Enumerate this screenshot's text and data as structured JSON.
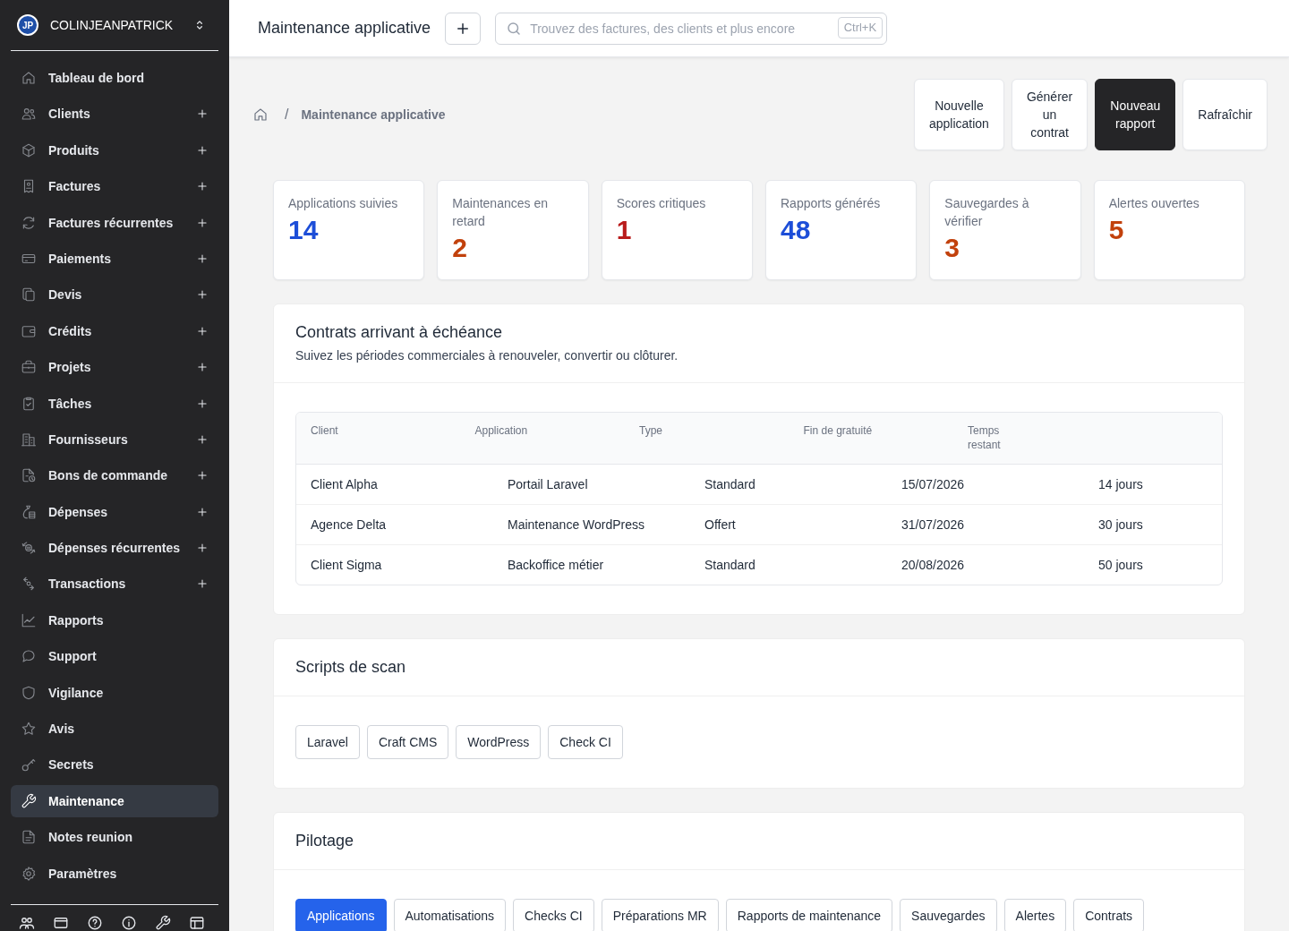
{
  "sidebar": {
    "account": {
      "initials": "JP",
      "name": "COLINJEANPATRICK"
    },
    "items": [
      {
        "label": "Tableau de bord",
        "can_add": false,
        "selected": false
      },
      {
        "label": "Clients",
        "can_add": true,
        "selected": false
      },
      {
        "label": "Produits",
        "can_add": true,
        "selected": false
      },
      {
        "label": "Factures",
        "can_add": true,
        "selected": false
      },
      {
        "label": "Factures récurrentes",
        "can_add": true,
        "selected": false
      },
      {
        "label": "Paiements",
        "can_add": true,
        "selected": false
      },
      {
        "label": "Devis",
        "can_add": true,
        "selected": false
      },
      {
        "label": "Crédits",
        "can_add": true,
        "selected": false
      },
      {
        "label": "Projets",
        "can_add": true,
        "selected": false
      },
      {
        "label": "Tâches",
        "can_add": true,
        "selected": false
      },
      {
        "label": "Fournisseurs",
        "can_add": true,
        "selected": false
      },
      {
        "label": "Bons de commande",
        "can_add": true,
        "selected": false
      },
      {
        "label": "Dépenses",
        "can_add": true,
        "selected": false
      },
      {
        "label": "Dépenses récurrentes",
        "can_add": true,
        "selected": false
      },
      {
        "label": "Transactions",
        "can_add": true,
        "selected": false
      },
      {
        "label": "Rapports",
        "can_add": false,
        "selected": false
      },
      {
        "label": "Support",
        "can_add": false,
        "selected": false
      },
      {
        "label": "Vigilance",
        "can_add": false,
        "selected": false
      },
      {
        "label": "Avis",
        "can_add": false,
        "selected": false
      },
      {
        "label": "Secrets",
        "can_add": false,
        "selected": false
      },
      {
        "label": "Maintenance",
        "can_add": false,
        "selected": true
      },
      {
        "label": "Notes reunion",
        "can_add": false,
        "selected": false
      },
      {
        "label": "Paramètres",
        "can_add": false,
        "selected": false
      }
    ]
  },
  "topbar": {
    "title": "Maintenance applicative",
    "search": {
      "placeholder": "Trouvez des factures, des clients et plus encore",
      "shortcut": "Ctrl+K"
    }
  },
  "breadcrumb": {
    "separator": "/",
    "current": "Maintenance applicative"
  },
  "actions": [
    {
      "label": "Nouvelle application",
      "kind": "secondary"
    },
    {
      "label": "Générer un contrat",
      "kind": "secondary"
    },
    {
      "label": "Nouveau rapport",
      "kind": "primary"
    },
    {
      "label": "Rafraîchir",
      "kind": "secondary"
    }
  ],
  "stats": [
    {
      "label": "Applications suivies",
      "value": "14",
      "color": "#1d4ed8"
    },
    {
      "label": "Maintenances en retard",
      "value": "2",
      "color": "#c2410c"
    },
    {
      "label": "Scores critiques",
      "value": "1",
      "color": "#b91c1c"
    },
    {
      "label": "Rapports générés",
      "value": "48",
      "color": "#1d4ed8"
    },
    {
      "label": "Sauvegardes à vérifier",
      "value": "3",
      "color": "#c2410c"
    },
    {
      "label": "Alertes ouvertes",
      "value": "5",
      "color": "#c2410c"
    }
  ],
  "contracts": {
    "title": "Contrats arrivant à échéance",
    "subtitle": "Suivez les périodes commerciales à renouveler, convertir ou clôturer.",
    "table": {
      "columns": [
        "Client",
        "Application",
        "Type",
        "Fin de gratuité",
        "Temps restant"
      ],
      "rows": [
        [
          "Client Alpha",
          "Portail Laravel",
          "Standard",
          "15/07/2026",
          "14 jours"
        ],
        [
          "Agence Delta",
          "Maintenance WordPress",
          "Offert",
          "31/07/2026",
          "30 jours"
        ],
        [
          "Client Sigma",
          "Backoffice métier",
          "Standard",
          "20/08/2026",
          "50 jours"
        ]
      ]
    }
  },
  "scripts": {
    "title": "Scripts de scan",
    "buttons": [
      "Laravel",
      "Craft CMS",
      "WordPress",
      "Check CI"
    ]
  },
  "pilotage": {
    "title": "Pilotage",
    "tabs": [
      {
        "label": "Applications",
        "selected": true
      },
      {
        "label": "Automatisations",
        "selected": false
      },
      {
        "label": "Checks CI",
        "selected": false
      },
      {
        "label": "Préparations MR",
        "selected": false
      },
      {
        "label": "Rapports de maintenance",
        "selected": false
      },
      {
        "label": "Sauvegardes",
        "selected": false
      },
      {
        "label": "Alertes",
        "selected": false
      },
      {
        "label": "Contrats",
        "selected": false
      }
    ]
  }
}
